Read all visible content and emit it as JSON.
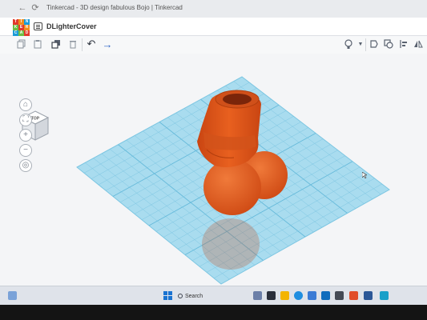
{
  "window": {
    "title": "Tinkercad - 3D design fabulous Bojo | Tinkercad"
  },
  "header": {
    "logo_letters": [
      "T",
      "I",
      "N",
      "K",
      "E",
      "R",
      "C",
      "A",
      "D"
    ],
    "logo_colors": [
      "#e2382c",
      "#f28c1c",
      "#1a9bd6",
      "#6cbe45",
      "#e2382c",
      "#f28c1c",
      "#1a9bd6",
      "#6cbe45",
      "#e2382c"
    ],
    "document_name": "DLighterCover"
  },
  "toolbar": {
    "tools": [
      "copy",
      "paste",
      "duplicate",
      "delete",
      "undo",
      "redo"
    ],
    "right_tools": [
      "light-bulb",
      "dropdown",
      "shape",
      "group",
      "align",
      "mirror"
    ]
  },
  "viewcube": {
    "face_label": "TOP"
  },
  "view_controls": [
    "home",
    "fit",
    "zoom-in",
    "zoom-out",
    "perspective"
  ],
  "taskbar": {
    "search_label": "Search"
  },
  "colors": {
    "workplane": "#a9dcef",
    "grid": "#6fc0df",
    "model": "#e2571c"
  }
}
